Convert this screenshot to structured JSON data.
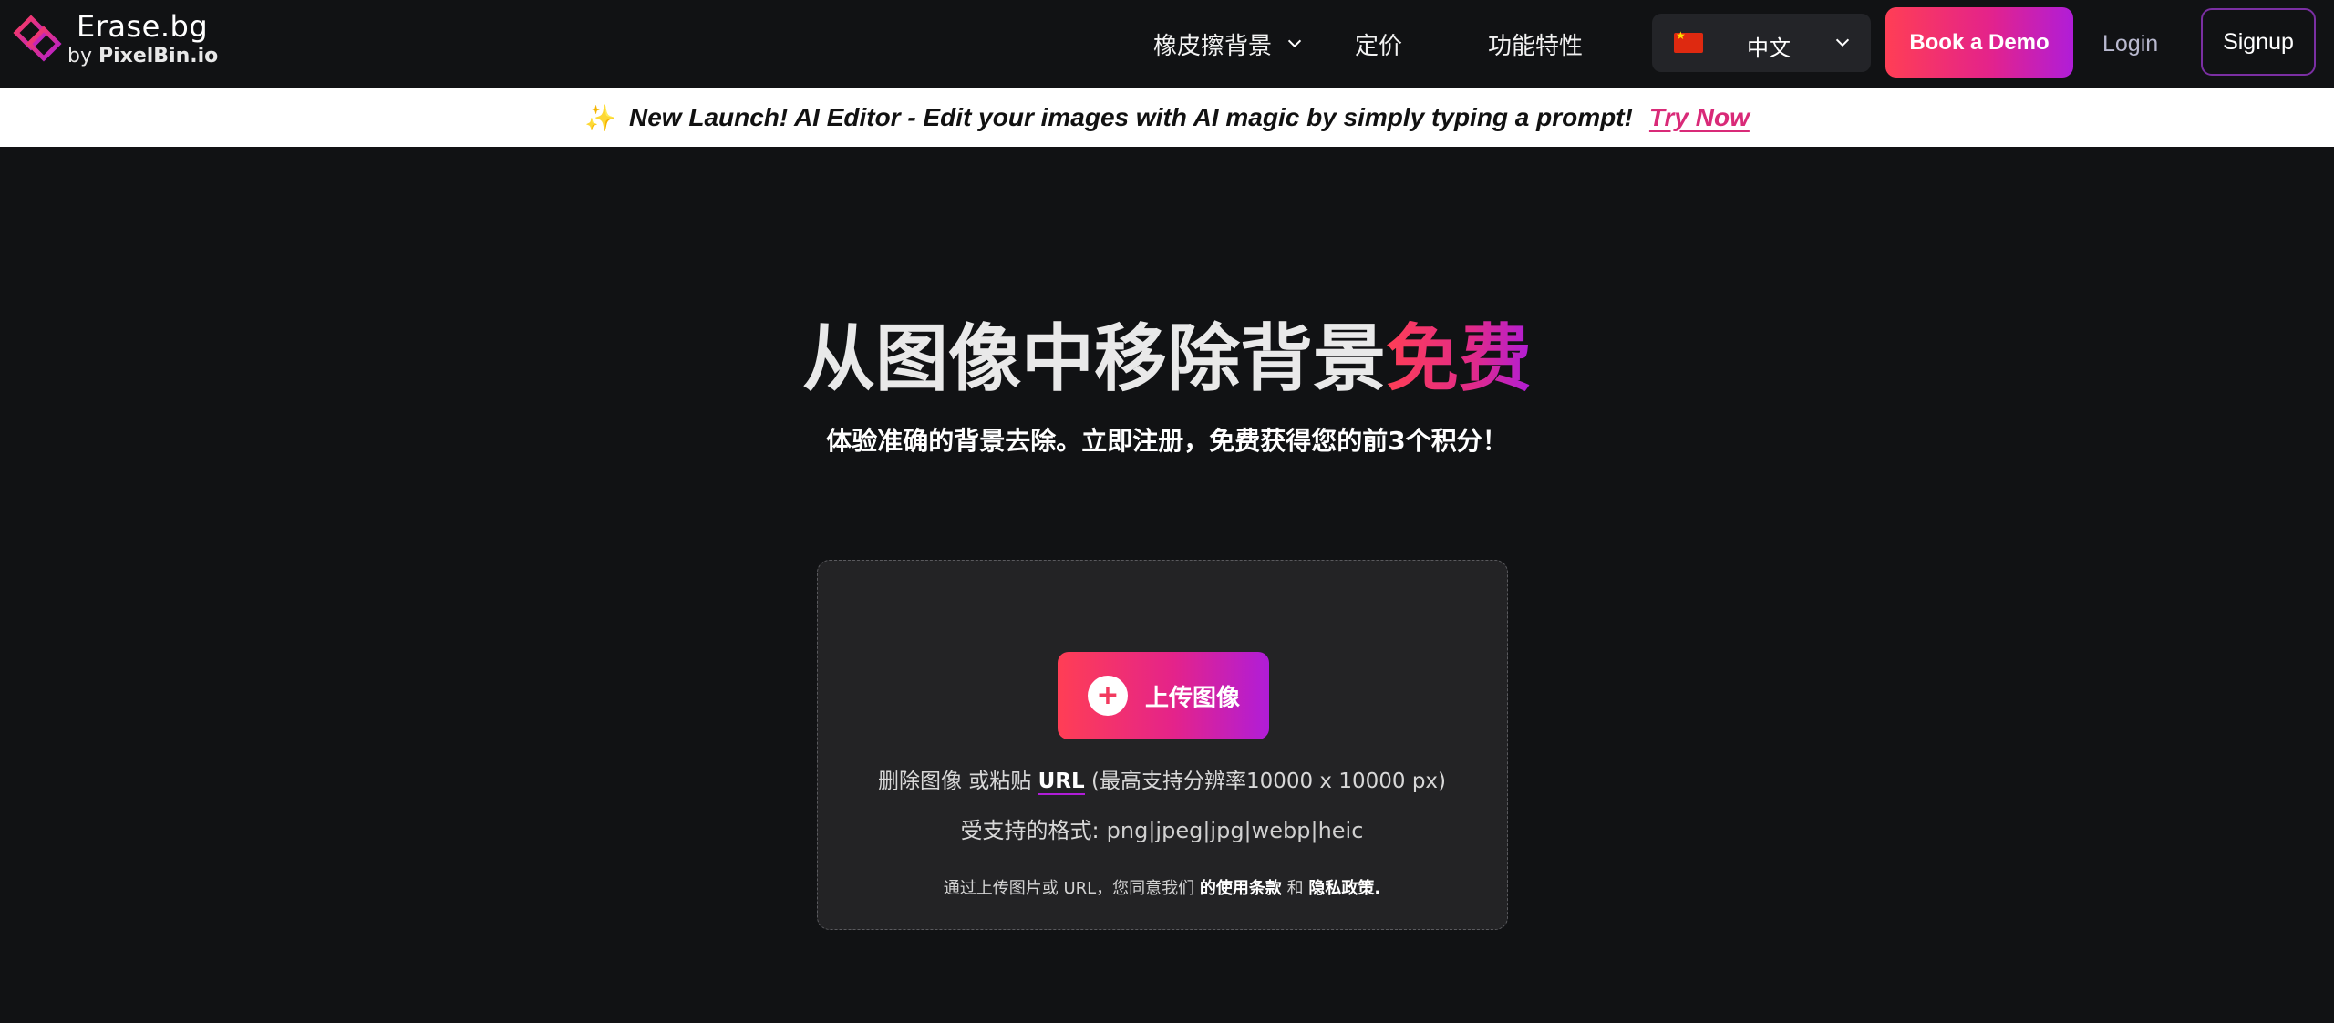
{
  "header": {
    "logo": {
      "title": "Erase.bg",
      "by": "by",
      "brand": "PixelBin.io"
    },
    "nav": [
      {
        "label": "橡皮擦背景",
        "has_dropdown": true
      },
      {
        "label": "定价",
        "has_dropdown": false
      },
      {
        "label": "功能特性",
        "has_dropdown": false
      }
    ],
    "language": {
      "label": "中文",
      "flag": "china-flag-icon"
    },
    "book_demo_label": "Book a Demo",
    "login_label": "Login",
    "signup_label": "Signup"
  },
  "banner": {
    "icon": "sparkle-icon",
    "text": "New Launch! AI Editor - Edit your images with AI magic by simply typing a prompt!",
    "link_label": "Try Now"
  },
  "hero": {
    "title": "从图像中移除背景",
    "title_accent": "免费",
    "subtitle": "体验准确的背景去除。立即注册，免费获得您的前3个积分！"
  },
  "upload": {
    "button_icon": "plus-icon",
    "button_label": "上传图像",
    "drop_prefix": "删除图像 或粘贴",
    "url_label": "URL",
    "drop_suffix": "(最高支持分辨率10000 x 10000 px)",
    "formats_label": "受支持的格式:",
    "formats": "png|jpeg|jpg|webp|heic",
    "terms_prefix": "通过上传图片或 URL，您同意我们",
    "terms_link": "的使用条款",
    "terms_and": "和",
    "privacy_link": "隐私政策."
  },
  "colors": {
    "background": "#111214",
    "accent_start": "#ff3e55",
    "accent_end": "#b01dd8",
    "card": "#232325"
  }
}
